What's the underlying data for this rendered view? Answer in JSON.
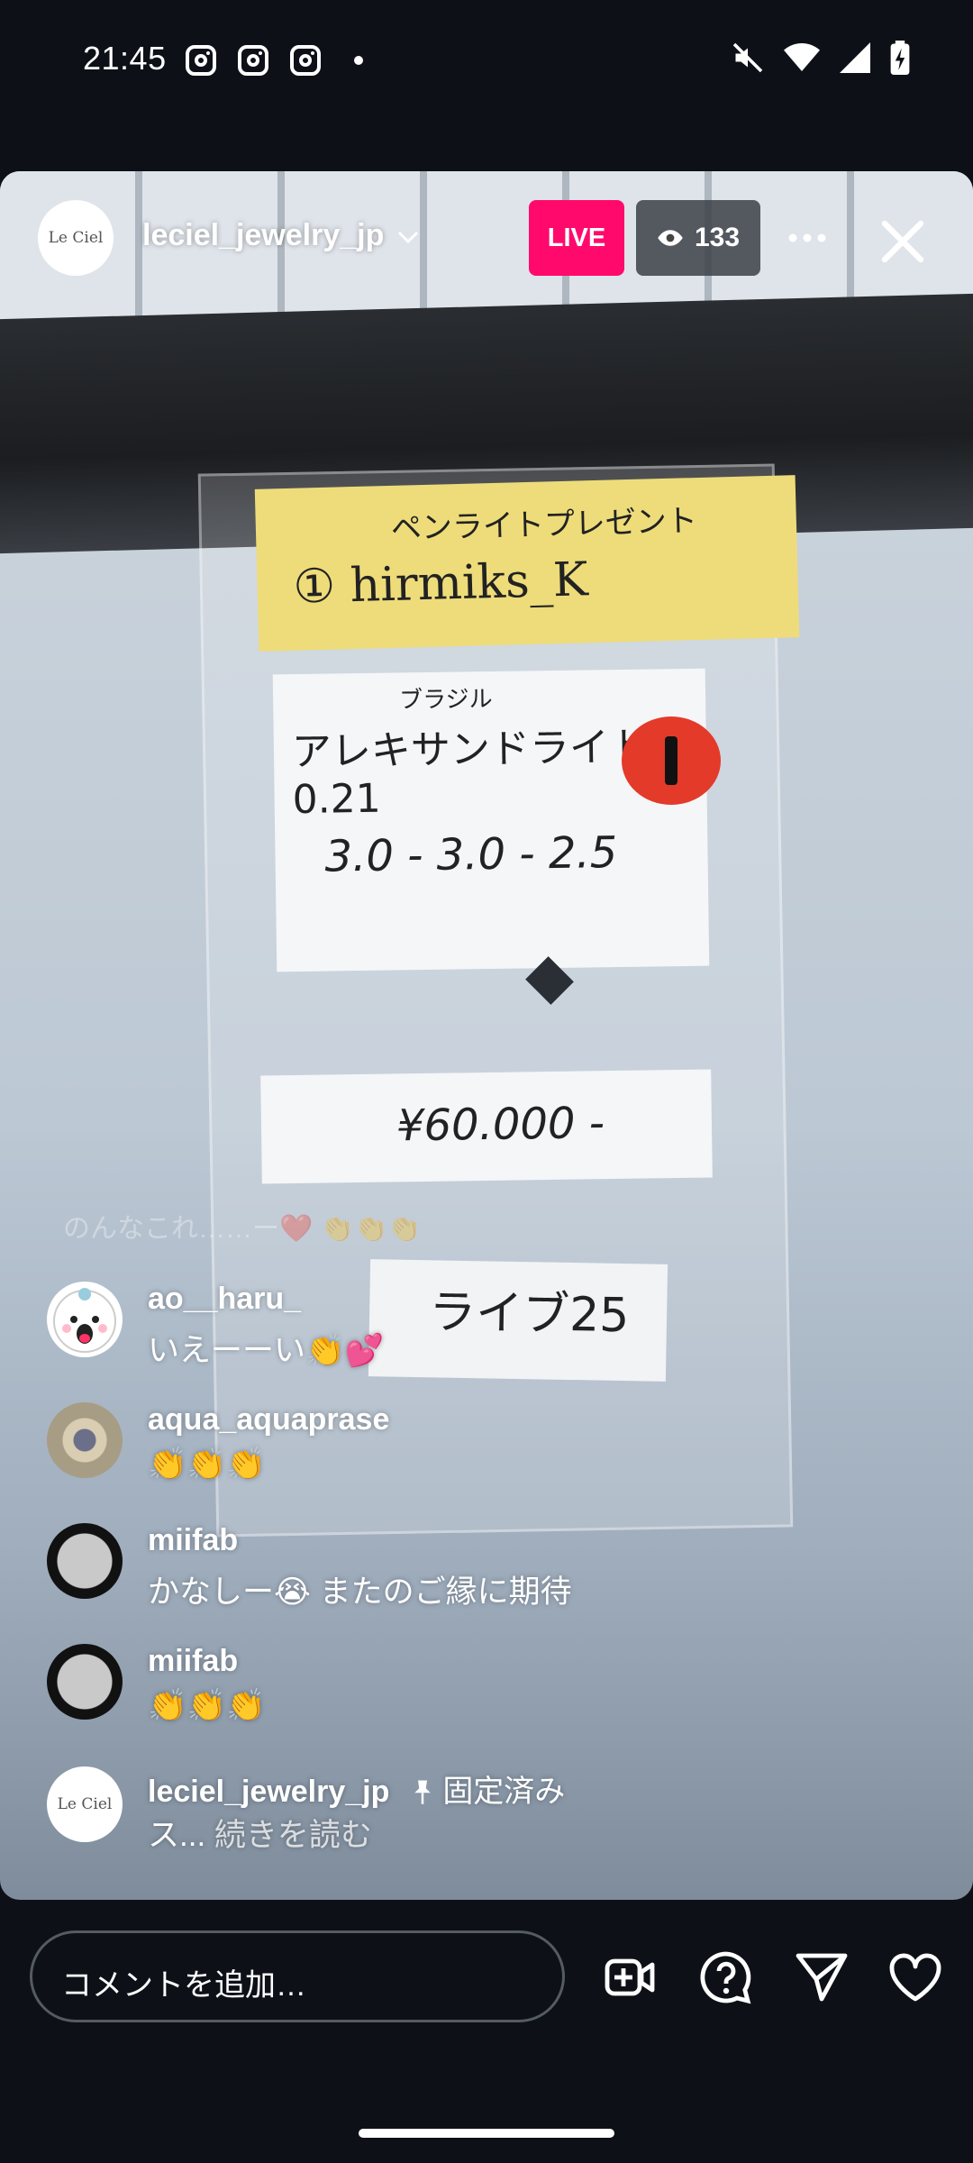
{
  "status_bar": {
    "time": "21:45",
    "notification_icons": [
      "instagram-icon",
      "instagram-icon",
      "instagram-icon",
      "dot-icon"
    ],
    "right_icons": [
      "mute-icon",
      "wifi-icon",
      "signal-icon",
      "battery-charging-icon"
    ]
  },
  "live_header": {
    "username": "leciel_jewelry_jp",
    "avatar_text": "Le Ciel",
    "live_badge": "LIVE",
    "viewer_count": "133"
  },
  "video_scene": {
    "note_line1": "ペンライトプレゼント",
    "note_line2": "① hirmiks_K",
    "card_sub": "ブラジル",
    "card_name": "アレキサンドライト 0.21",
    "card_size": "3.0 - 3.0 - 2.5",
    "card_price": "¥60.000 -",
    "label": "ライブ25"
  },
  "comments": {
    "ghost_text": "のんなこれ……ー❤️ 👏👏👏",
    "items": [
      {
        "user": "ao__haru_",
        "text": "いえーーい👏💕"
      },
      {
        "user": "aqua_aquaprase",
        "text": "👏👏👏"
      },
      {
        "user": "miifab",
        "text": "かなしー😭 またのご縁に期待"
      },
      {
        "user": "miifab",
        "text": "👏👏👏"
      }
    ],
    "pinned": {
      "user": "leciel_jewelry_jp",
      "pin_label": "固定済み",
      "text": "ス...",
      "more": "続きを読む",
      "avatar_text": "Le Ciel"
    }
  },
  "composer": {
    "placeholder": "コメントを追加…"
  },
  "colors": {
    "live": "#ff0a6c",
    "background": "#0d1117"
  }
}
